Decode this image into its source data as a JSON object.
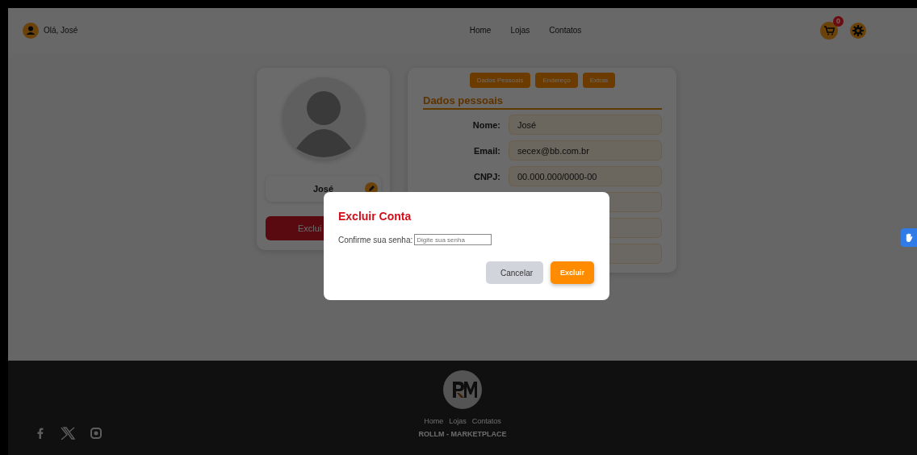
{
  "header": {
    "greeting": "Olá, José",
    "nav": [
      "Home",
      "Lojas",
      "Contatos"
    ],
    "cart_count": "0"
  },
  "profile": {
    "name": "José",
    "delete_button": "Exclui"
  },
  "details": {
    "tabs": [
      "Dados Pessoais",
      "Endereço",
      "Extras"
    ],
    "heading": "Dados pessoais",
    "fields": [
      {
        "kind": "text",
        "label": "Nome:",
        "value": "José"
      },
      {
        "kind": "text",
        "label": "Email:",
        "value": "secex@bb.com.br"
      },
      {
        "kind": "text",
        "label": "CNPJ:",
        "value": "00.000.000/0000-00"
      },
      {
        "kind": "blank"
      },
      {
        "kind": "blank"
      },
      {
        "kind": "blank"
      }
    ]
  },
  "modal": {
    "title": "Excluir Conta",
    "label": "Confirme sua senha:",
    "placeholder": "Digite sua senha",
    "buttons": [
      {
        "kind": "secondary",
        "label": "Cancelar"
      },
      {
        "kind": "danger",
        "label": "Excluir"
      }
    ]
  },
  "footer": {
    "links": [
      "Home",
      "Lojas",
      "Contatos"
    ],
    "brand": "ROLLM - MARKETPLACE"
  }
}
